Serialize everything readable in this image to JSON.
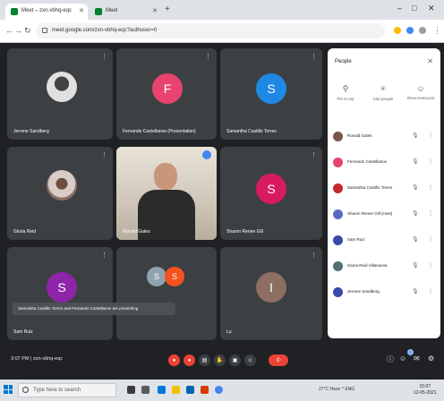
{
  "browser": {
    "tabs": [
      {
        "title": "Meet – zxn-vbhq-eqc"
      },
      {
        "title": "Meet"
      }
    ],
    "url": "meet.google.com/zxn-vbhq-eqc?authuser=0"
  },
  "tiles": [
    {
      "name": "Jerome Sandberg",
      "avatar_type": "photo",
      "avatar_color": "#bdbdbd"
    },
    {
      "name": "Fernando Castellanos (Presentation)",
      "avatar_letter": "F",
      "avatar_color": "#e8436f"
    },
    {
      "name": "Samantha Castillo Torres",
      "avatar_letter": "S",
      "avatar_color": "#1e88e5"
    },
    {
      "name": "Gloria Reid",
      "avatar_type": "photo",
      "avatar_color": "#a1887f"
    },
    {
      "name": "Ronald Gates",
      "avatar_type": "video"
    },
    {
      "name": "Sharon Renee Gill",
      "avatar_letter": "S",
      "avatar_color": "#d81b60"
    },
    {
      "name": "Sam Ruiz",
      "avatar_letter": "S",
      "avatar_color": "#8e24aa"
    },
    {
      "name": "",
      "avatar_letter": "S",
      "avatar_color": "#f4511e"
    },
    {
      "name": "Lu",
      "avatar_letter": "I",
      "avatar_color": "#8d6e63"
    }
  ],
  "panel": {
    "title": "People",
    "actions": [
      {
        "label": "Pin to top",
        "icon": "pin-icon"
      },
      {
        "label": "Add people",
        "icon": "add-person-icon"
      },
      {
        "label": "Show everyone",
        "icon": "people-icon"
      }
    ],
    "participants": [
      {
        "name": "Ronald Gates",
        "color": "#795548"
      },
      {
        "name": "Fernando Castellanos",
        "color": "#e8436f"
      },
      {
        "name": "Samantha Castillo Torres",
        "color": "#c62828"
      },
      {
        "name": "Sharon Renee Gill (Host)",
        "color": "#5c6bc0"
      },
      {
        "name": "Sam Ruiz",
        "color": "#3949ab"
      },
      {
        "name": "Gloria Reid Villanueva",
        "color": "#546e7a"
      },
      {
        "name": "Jerome Sandberg",
        "color": "#3949ab"
      }
    ]
  },
  "caption": "Samantha Castillo Torres and Fernando Castellanos are presenting",
  "bottombar": {
    "time": "3:07 PM",
    "meeting_code": "zxn-vbhq-eqc"
  },
  "taskbar": {
    "search_placeholder": "Type here to search",
    "tray_text": "27°C Haze ^ ENG",
    "clock_time": "15:07",
    "clock_date": "12-05-2021"
  },
  "colors": {
    "end_call": "#ea4335",
    "meet_bg": "#202124",
    "tile_bg": "#3c4043"
  }
}
